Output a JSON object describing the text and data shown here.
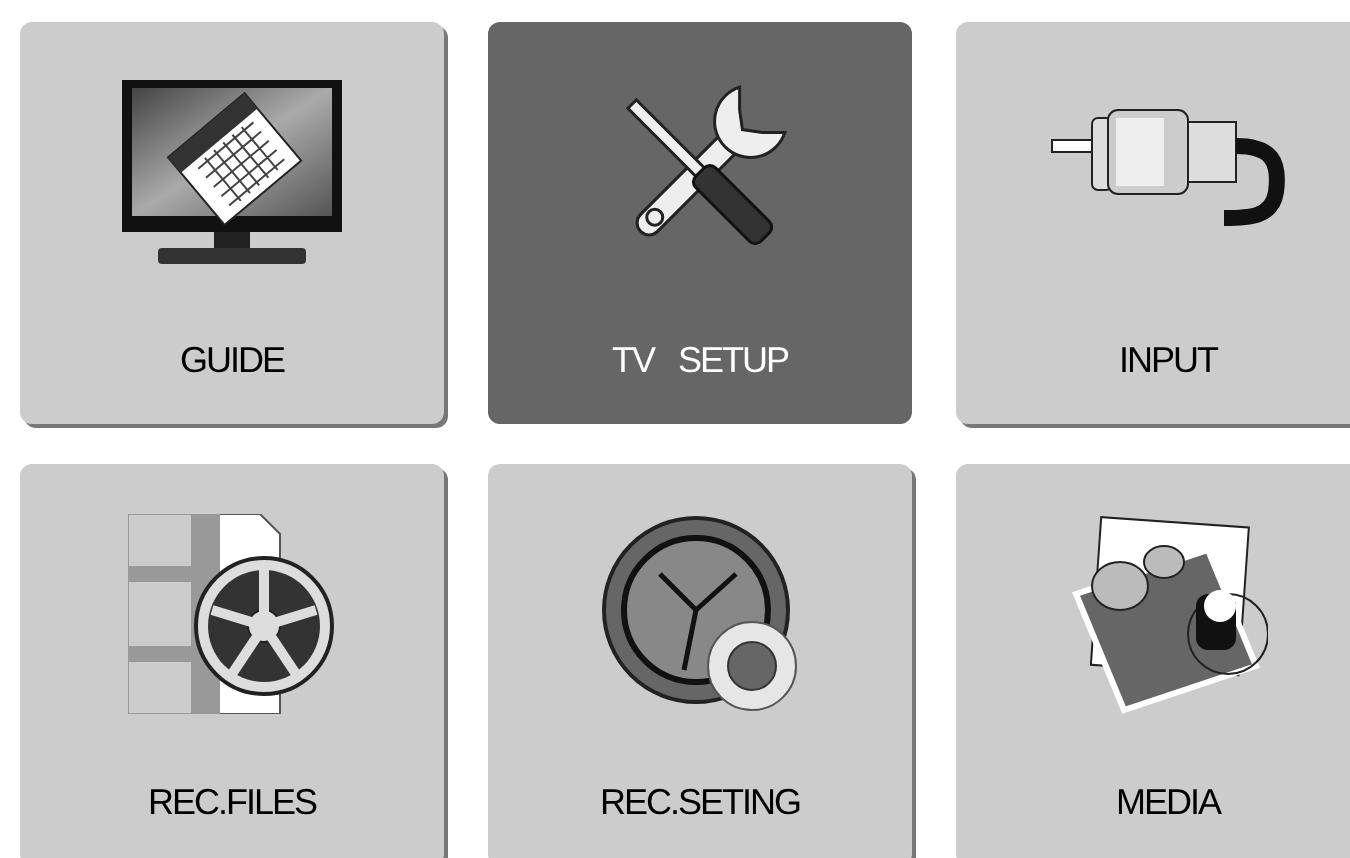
{
  "menu": [
    {
      "label": "GUIDE",
      "kind": "tv",
      "selected": false
    },
    {
      "label": "TV   SETUP",
      "kind": "tools",
      "selected": true
    },
    {
      "label": "INPUT",
      "kind": "plug",
      "selected": false
    },
    {
      "label": "REC.FILES",
      "kind": "film",
      "selected": false
    },
    {
      "label": "REC.SETING",
      "kind": "clock",
      "selected": false
    },
    {
      "label": "MEDIA",
      "kind": "photo",
      "selected": false
    }
  ]
}
